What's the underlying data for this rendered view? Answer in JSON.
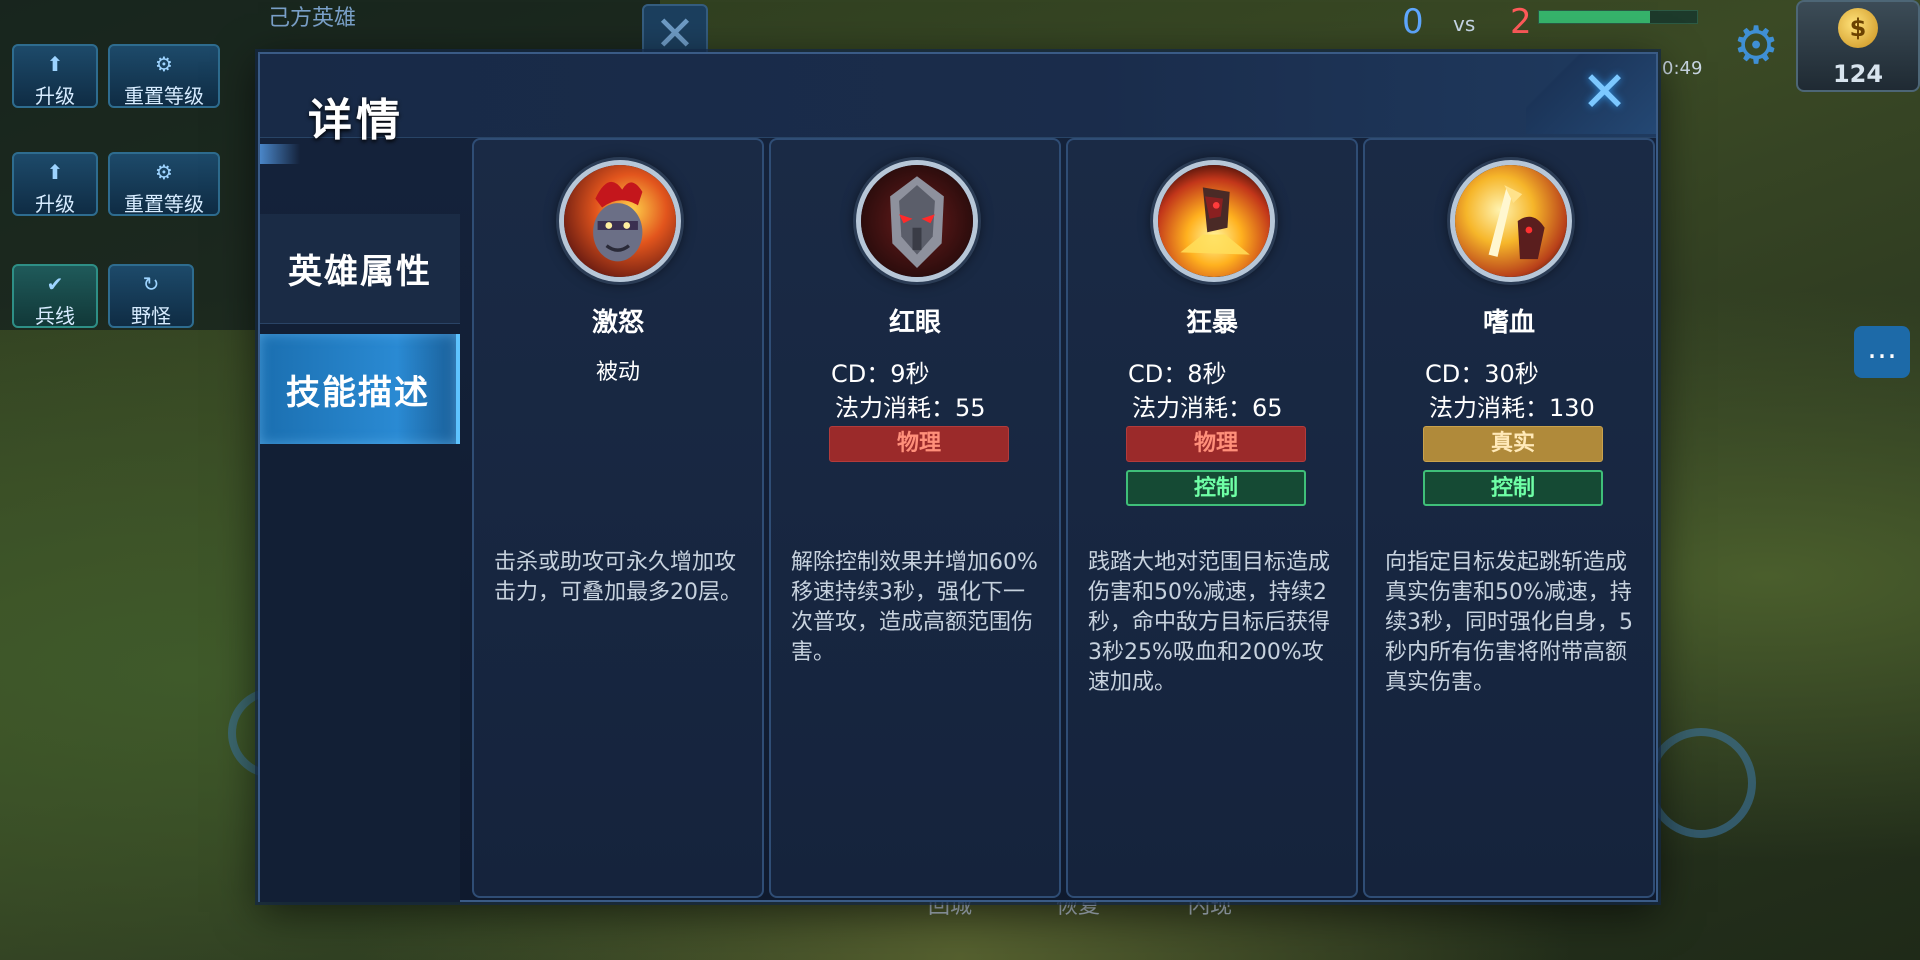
{
  "background": {
    "ally_heroes_title": "己方英雄",
    "row1": [
      {
        "glyph": "⬆",
        "label": "升级"
      },
      {
        "glyph": "⚙",
        "label": "重置等级"
      }
    ],
    "row2": [
      {
        "glyph": "⬆",
        "label": "升级"
      },
      {
        "glyph": "⚙",
        "label": "重置等级"
      }
    ],
    "row3": [
      {
        "glyph": "✔",
        "label": "兵线"
      },
      {
        "glyph": "↻",
        "label": "野怪"
      }
    ],
    "score_left": "0",
    "vs": "vs",
    "score_right": "2",
    "time": "0:49",
    "gold": "124",
    "bottom_labels": [
      "回城",
      "恢复",
      "闪现"
    ]
  },
  "dialog": {
    "title": "详情",
    "close_icon": "close-icon",
    "tabs": [
      {
        "label": "英雄属性",
        "active": false
      },
      {
        "label": "技能描述",
        "active": true
      }
    ]
  },
  "skills": [
    {
      "name": "激怒",
      "subtitle": "被动",
      "icon": "rage-hero-icon",
      "description": "击杀或助攻可永久增加攻击力，可叠加最多20层。"
    },
    {
      "name": "红眼",
      "cd": "CD：9秒",
      "mana": "法力消耗：55",
      "tags": [
        "物理"
      ],
      "icon": "red-eye-helmet-icon",
      "description": "解除控制效果并增加60%移速持续3秒，强化下一次普攻，造成高额范围伤害。"
    },
    {
      "name": "狂暴",
      "cd": "CD：8秒",
      "mana": "法力消耗：65",
      "tags": [
        "物理",
        "控制"
      ],
      "icon": "frenzy-slam-icon",
      "description": "践踏大地对范围目标造成伤害和50%减速，持续2秒，命中敌方目标后获得3秒25%吸血和200%攻速加成。"
    },
    {
      "name": "嗜血",
      "cd": "CD：30秒",
      "mana": "法力消耗：130",
      "tags": [
        "真实",
        "控制"
      ],
      "icon": "bloodlust-leap-icon",
      "description": "向指定目标发起跳斩造成真实伤害和50%减速，持续3秒，同时强化自身，5秒内所有伤害将附带高额真实伤害。"
    }
  ],
  "colors": {
    "physical_tag": "#9b2a2a",
    "true_tag": "#b08a3a",
    "control_tag": "#154a34",
    "active_tab": "#2a8ad3"
  }
}
